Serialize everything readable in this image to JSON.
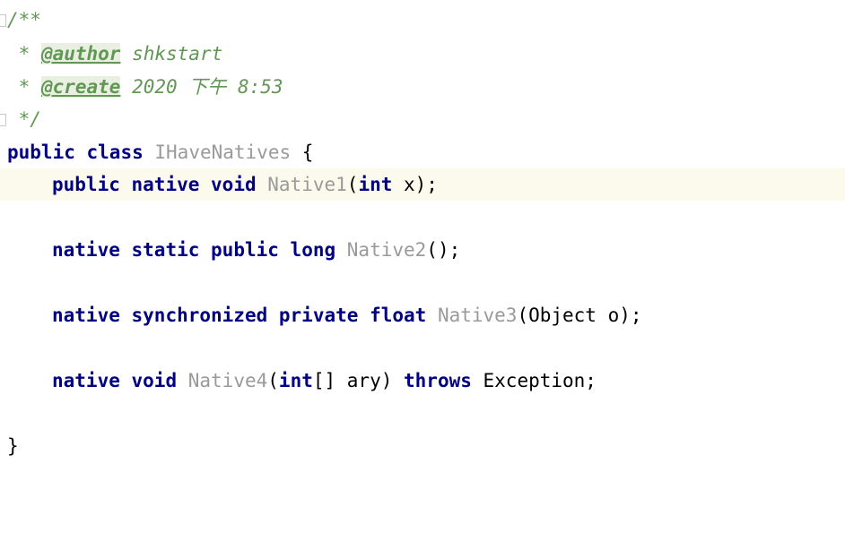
{
  "editor": {
    "doc_start": "/**",
    "doc_prefix": " * ",
    "author_tag": "@author",
    "author_value": " shkstart",
    "create_tag": "@create",
    "create_value": " 2020 下午 8:53",
    "doc_end": " */",
    "class_decl": {
      "kw_public": "public",
      "kw_class": "class",
      "name": "IHaveNatives",
      "open_brace": "{"
    },
    "method1": {
      "kw1": "public",
      "kw2": "native",
      "kw3": "void",
      "name": "Native1",
      "paren_open": "(",
      "param_kw": "int",
      "rest": " x);"
    },
    "method2": {
      "kw1": "native",
      "kw2": "static",
      "kw3": "public",
      "kw4": "long",
      "name": "Native2",
      "rest": "();"
    },
    "method3": {
      "kw1": "native",
      "kw2": "synchronized",
      "kw3": "private",
      "kw4": "float",
      "name": "Native3",
      "rest": "(Object o);"
    },
    "method4": {
      "kw1": "native",
      "kw2": "void",
      "name": "Native4",
      "paren_open": "(",
      "param_kw": "int",
      "param_rest": "[] ary) ",
      "throws_kw": "throws",
      "rest": " Exception;"
    },
    "close_brace": "}"
  },
  "colors": {
    "keyword": "#000080",
    "comment": "#629755",
    "identifier": "#9a9a9a",
    "current_line": "#fcfaed"
  }
}
